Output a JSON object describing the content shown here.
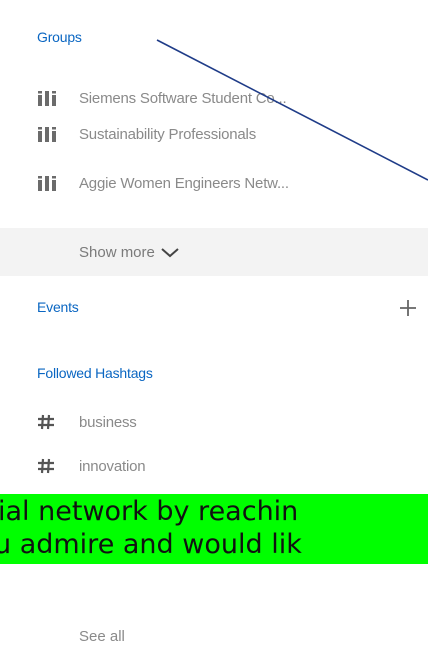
{
  "groups": {
    "title": "Groups",
    "items": [
      {
        "label": "Siemens Software Student Co...",
        "icon": "group-icon"
      },
      {
        "label": "Sustainability Professionals",
        "icon": "group-icon"
      },
      {
        "label": "Aggie Women Engineers Netw...",
        "icon": "group-icon"
      }
    ],
    "show_more": "Show more"
  },
  "events": {
    "title": "Events",
    "add_icon": "plus-icon"
  },
  "hashtags": {
    "title": "Followed Hashtags",
    "items": [
      {
        "label": "business",
        "icon": "hashtag-icon"
      },
      {
        "label": "innovation",
        "icon": "hashtag-icon"
      }
    ],
    "see_all": "See all"
  },
  "banner": {
    "line1": "ial network by reachin",
    "line2": "u admire and would lik",
    "color": "#00ff00"
  },
  "colors": {
    "link": "#0a66c2",
    "muted_text": "#8a8a8a",
    "highlight_band": "#f3f3f3",
    "annotation_line": "#1f3c88"
  }
}
